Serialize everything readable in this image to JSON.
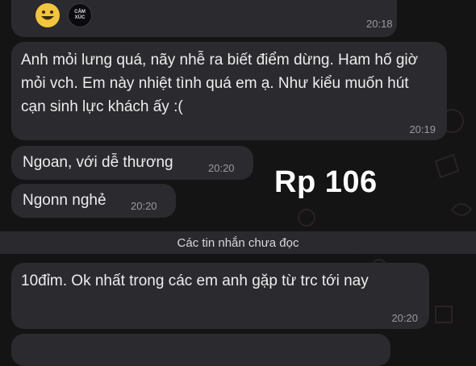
{
  "reactions": [
    {
      "icon": "grinning-face-icon"
    },
    {
      "icon": "cam-xuc-sticker-icon",
      "label_line1": "CẢM",
      "label_line2": "XÚC"
    }
  ],
  "messages": [
    {
      "time": "20:18"
    },
    {
      "text": "Anh mỏi lưng quá, nãy nhễ ra biết điểm dừng. Ham hố giờ mỏi vch. Em này nhiệt tình quá em ạ. Như kiểu muốn hút cạn sinh lực khách ấy :(",
      "time": "20:19"
    },
    {
      "text": "Ngoan, với dễ thương",
      "time": "20:20"
    },
    {
      "text": "Ngonn nghẻ",
      "time": "20:20"
    },
    {
      "text": "10đỉm. Ok nhất trong các em anh gặp từ trc tới nay",
      "time": "20:20"
    }
  ],
  "unread_divider": "Các tin nhắn chưa đọc",
  "overlay_label": "Rp 106",
  "colors": {
    "background": "#141414",
    "bubble": "#2b2a2f",
    "text": "#ededed",
    "time": "#9a9a9f"
  }
}
